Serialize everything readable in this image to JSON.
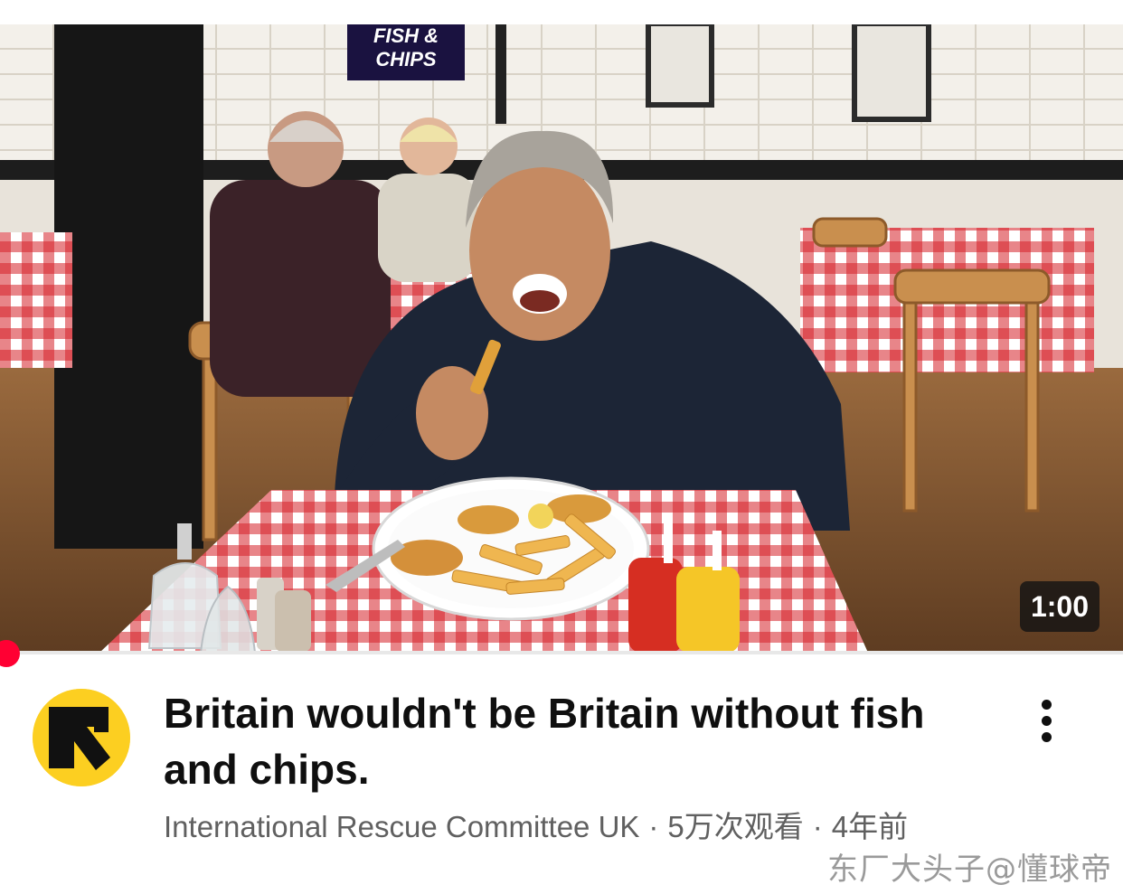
{
  "video": {
    "title": "Britain wouldn't be Britain without fish and chips.",
    "duration": "1:00",
    "thumbnail_sign": [
      "FISH &",
      "CHIPS"
    ],
    "progress_fraction": 0
  },
  "channel": {
    "name": "International Rescue Committee UK",
    "views": "5万次观看",
    "age": "4年前",
    "separator": "·",
    "avatar_color": "#fccf21"
  },
  "watermark": "东厂大头子@懂球帝",
  "colors": {
    "progress_accent": "#ff0033",
    "title_text": "#0f0f0f",
    "meta_text": "#606060"
  },
  "icons": {
    "more": "vertical-ellipsis-icon",
    "channel_logo": "irc-arrow-logo"
  }
}
